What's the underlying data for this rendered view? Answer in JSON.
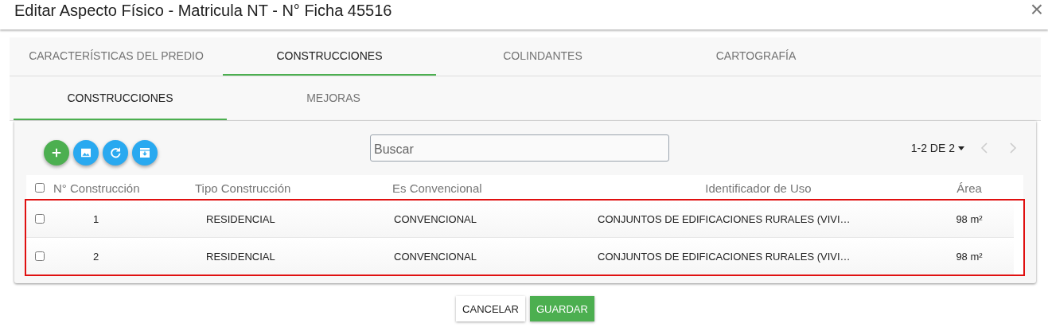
{
  "dialog": {
    "title": "Editar Aspecto Físico - Matricula NT - N° Ficha 45516",
    "close": "×"
  },
  "tabs": [
    {
      "label": "CARACTERÍSTICAS DEL PREDIO",
      "selected": false
    },
    {
      "label": "CONSTRUCCIONES",
      "selected": true
    },
    {
      "label": "COLINDANTES",
      "selected": false
    },
    {
      "label": "CARTOGRAFÍA",
      "selected": false
    }
  ],
  "subtabs": [
    {
      "label": "CONSTRUCCIONES",
      "selected": true
    },
    {
      "label": "MEJORAS",
      "selected": false
    }
  ],
  "toolbar": [
    {
      "kind": "add",
      "color": "#4caf50"
    },
    {
      "kind": "image",
      "color": "#29a9f0"
    },
    {
      "kind": "refresh",
      "color": "#29a9f0"
    },
    {
      "kind": "archive",
      "color": "#29a9f0"
    }
  ],
  "search": {
    "placeholder": "Buscar"
  },
  "pagination": {
    "range": "1-2 DE 2",
    "prev_disabled": true,
    "next_disabled": true
  },
  "table": {
    "select_all_checked": false,
    "rows_highlighted": true,
    "columns": [
      "N° Construcción",
      "Tipo Construcción",
      "Es Convencional",
      "Identificador de Uso",
      "Área"
    ],
    "rows": [
      {
        "checked": false,
        "cells": [
          "1",
          "RESIDENCIAL",
          "CONVENCIONAL",
          "CONJUNTOS DE EDIFICACIONES RURALES (VIVI…",
          "98 m²"
        ]
      },
      {
        "checked": false,
        "cells": [
          "2",
          "RESIDENCIAL",
          "CONVENCIONAL",
          "CONJUNTOS DE EDIFICACIONES RURALES (VIVI…",
          "98 m²"
        ]
      }
    ]
  },
  "buttons": [
    {
      "label": "CANCELAR",
      "kind": "flat"
    },
    {
      "label": "GUARDAR",
      "kind": "primary"
    }
  ]
}
